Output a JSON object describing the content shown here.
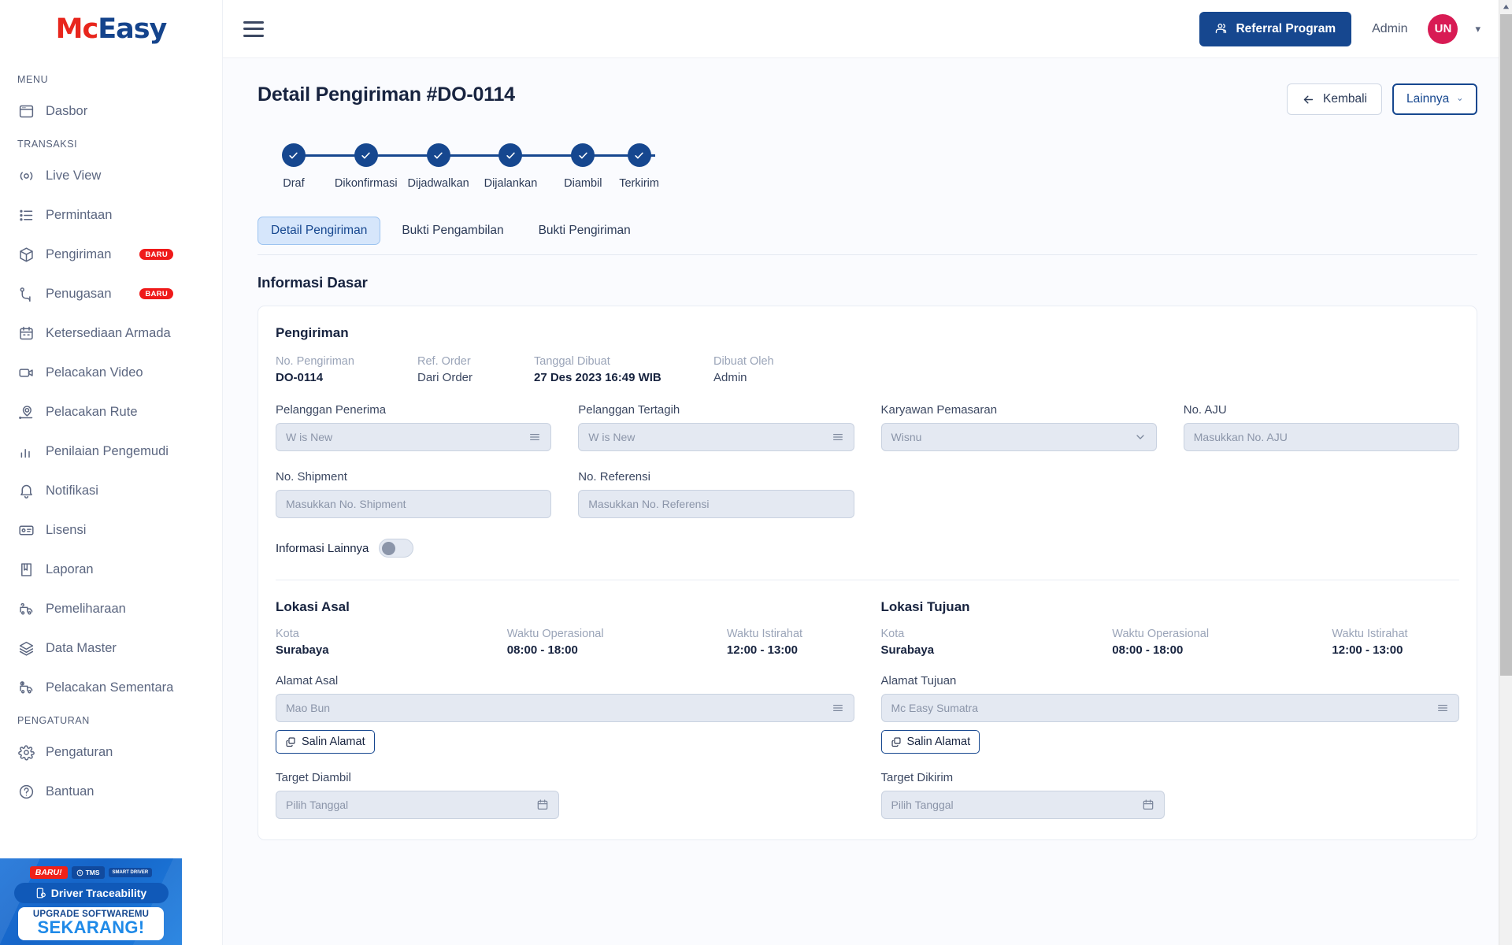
{
  "brand": {
    "logo_mc": "Mc",
    "logo_easy": "Easy",
    "accent_red": "#e8261d",
    "accent_blue": "#15448c"
  },
  "sidebar": {
    "sections": [
      {
        "label": "MENU",
        "items": [
          {
            "label": "Dasbor",
            "icon": "dashboard-icon",
            "badge": null
          }
        ]
      },
      {
        "label": "TRANSAKSI",
        "items": [
          {
            "label": "Live View",
            "icon": "live-view-icon",
            "badge": null
          },
          {
            "label": "Permintaan",
            "icon": "list-icon",
            "badge": null
          },
          {
            "label": "Pengiriman",
            "icon": "package-icon",
            "badge": "BARU"
          },
          {
            "label": "Penugasan",
            "icon": "route-icon",
            "badge": "BARU"
          },
          {
            "label": "Ketersediaan Armada",
            "icon": "calendar-icon",
            "badge": null
          },
          {
            "label": "Pelacakan Video",
            "icon": "video-icon",
            "badge": null
          },
          {
            "label": "Pelacakan Rute",
            "icon": "map-pin-icon",
            "badge": null
          },
          {
            "label": "Penilaian Pengemudi",
            "icon": "bar-chart-icon",
            "badge": null
          },
          {
            "label": "Notifikasi",
            "icon": "bell-icon",
            "badge": null
          },
          {
            "label": "Lisensi",
            "icon": "id-card-icon",
            "badge": null
          },
          {
            "label": "Laporan",
            "icon": "book-icon",
            "badge": null
          },
          {
            "label": "Pemeliharaan",
            "icon": "truck-wrench-icon",
            "badge": null
          },
          {
            "label": "Data Master",
            "icon": "layers-icon",
            "badge": null
          },
          {
            "label": "Pelacakan Sementara",
            "icon": "truck-clock-icon",
            "badge": null
          }
        ]
      },
      {
        "label": "PENGATURAN",
        "items": [
          {
            "label": "Pengaturan",
            "icon": "gear-icon",
            "badge": null
          },
          {
            "label": "Bantuan",
            "icon": "help-circle-icon",
            "badge": null
          }
        ]
      }
    ],
    "promo": {
      "chip_new": "BARU!",
      "chip_tms": "TMS",
      "chip_smart_driver": "SMART DRIVER",
      "title": "Driver Traceability",
      "cta_line1": "UPGRADE SOFTWAREMU",
      "cta_line2": "SEKARANG!"
    }
  },
  "topbar": {
    "menu_icon": "hamburger-icon",
    "referral_label": "Referral Program",
    "admin_label": "Admin",
    "avatar_initials": "UN",
    "avatar_color": "#d81b54"
  },
  "page": {
    "title": "Detail Pengiriman #DO-0114",
    "back_label": "Kembali",
    "more_label": "Lainnya"
  },
  "stepper": {
    "steps": [
      {
        "label": "Draf",
        "done": true
      },
      {
        "label": "Dikonfirmasi",
        "done": true
      },
      {
        "label": "Dijadwalkan",
        "done": true
      },
      {
        "label": "Dijalankan",
        "done": true
      },
      {
        "label": "Diambil",
        "done": true
      },
      {
        "label": "Terkirim",
        "done": true
      }
    ]
  },
  "tabs": [
    {
      "label": "Detail Pengiriman",
      "active": true
    },
    {
      "label": "Bukti Pengambilan",
      "active": false
    },
    {
      "label": "Bukti Pengiriman",
      "active": false
    }
  ],
  "section_heading": "Informasi Dasar",
  "shipment": {
    "card_title": "Pengiriman",
    "meta": [
      {
        "key": "No. Pengiriman",
        "value": "DO-0114",
        "bold": true
      },
      {
        "key": "Ref. Order",
        "value": "Dari Order",
        "bold": false
      },
      {
        "key": "Tanggal Dibuat",
        "value": "27 Des 2023 16:49 WIB",
        "bold": true
      },
      {
        "key": "Dibuat Oleh",
        "value": "Admin",
        "bold": false
      }
    ],
    "fields_row1": [
      {
        "label": "Pelanggan Penerima",
        "value": "W is New",
        "placeholder": "W is New",
        "icon": "list-lines-icon"
      },
      {
        "label": "Pelanggan Tertagih",
        "value": "W is New",
        "placeholder": "W is New",
        "icon": "list-lines-icon"
      },
      {
        "label": "Karyawan Pemasaran",
        "value": "Wisnu",
        "placeholder": "Wisnu",
        "icon": "chevron-down-icon"
      },
      {
        "label": "No. AJU",
        "value": "",
        "placeholder": "Masukkan No. AJU",
        "icon": null
      }
    ],
    "fields_row2": [
      {
        "label": "No. Shipment",
        "value": "",
        "placeholder": "Masukkan No. Shipment",
        "icon": null
      },
      {
        "label": "No. Referensi",
        "value": "",
        "placeholder": "Masukkan No. Referensi",
        "icon": null
      }
    ],
    "toggle": {
      "label": "Informasi Lainnya",
      "on": false
    }
  },
  "locations": [
    {
      "title": "Lokasi Asal",
      "meta": [
        {
          "key": "Kota",
          "value": "Surabaya"
        },
        {
          "key": "Waktu Operasional",
          "value": "08:00 - 18:00"
        },
        {
          "key": "Waktu Istirahat",
          "value": "12:00 - 13:00"
        }
      ],
      "address_label": "Alamat Asal",
      "address_value": "Mao Bun",
      "copy_label": "Salin Alamat",
      "target_label": "Target Diambil",
      "target_placeholder": "Pilih Tanggal"
    },
    {
      "title": "Lokasi Tujuan",
      "meta": [
        {
          "key": "Kota",
          "value": "Surabaya"
        },
        {
          "key": "Waktu Operasional",
          "value": "08:00 - 18:00"
        },
        {
          "key": "Waktu Istirahat",
          "value": "12:00 - 13:00"
        }
      ],
      "address_label": "Alamat Tujuan",
      "address_value": "Mc Easy Sumatra",
      "copy_label": "Salin Alamat",
      "target_label": "Target Dikirim",
      "target_placeholder": "Pilih Tanggal"
    }
  ]
}
